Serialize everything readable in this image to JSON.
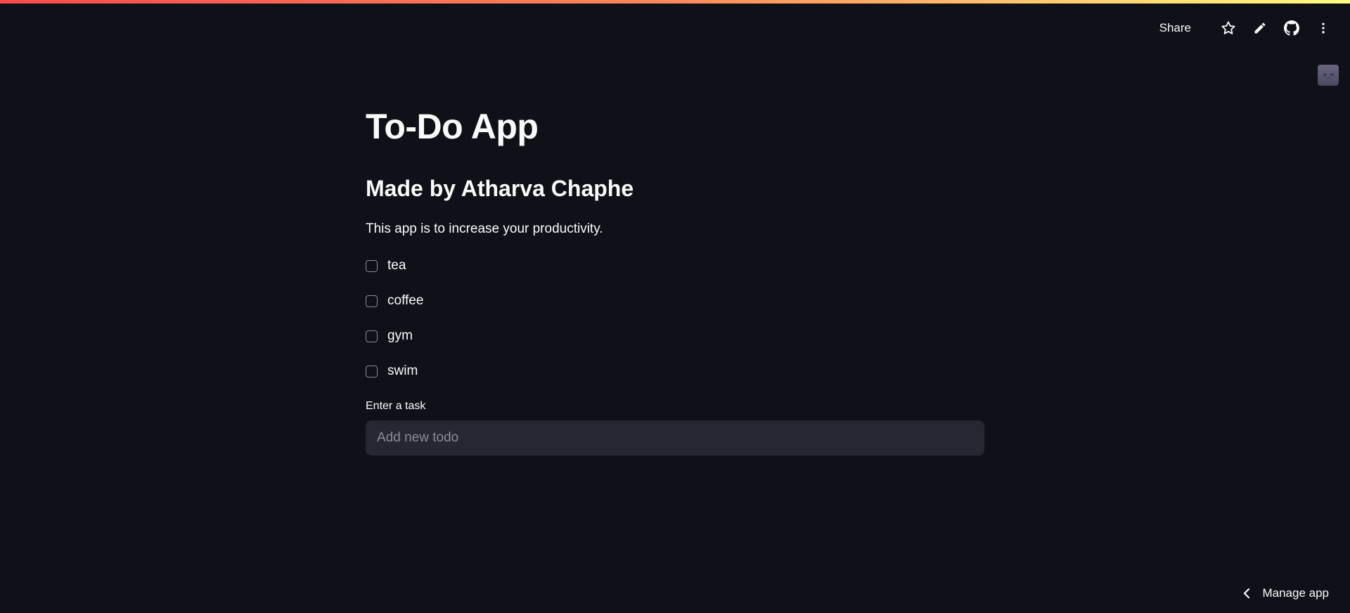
{
  "toolbar": {
    "share_label": "Share",
    "icons": [
      "star-icon",
      "pencil-icon",
      "github-icon",
      "more-vert-icon"
    ]
  },
  "status_widget": {
    "glyph": ">_<"
  },
  "main": {
    "title": "To-Do App",
    "subtitle": "Made by Atharva Chaphe",
    "description": "This app is to increase your productivity.",
    "todos": [
      {
        "label": "tea",
        "checked": false
      },
      {
        "label": "coffee",
        "checked": false
      },
      {
        "label": "gym",
        "checked": false
      },
      {
        "label": "swim",
        "checked": false
      }
    ],
    "input": {
      "label": "Enter a task",
      "placeholder": "Add new todo",
      "value": ""
    }
  },
  "footer": {
    "manage_app_label": "Manage app"
  },
  "colors": {
    "background": "#0e1117",
    "text": "#fafafa",
    "input_bg": "#262730",
    "gradient_start": "#ff4b4b",
    "gradient_end": "#fffd80"
  }
}
